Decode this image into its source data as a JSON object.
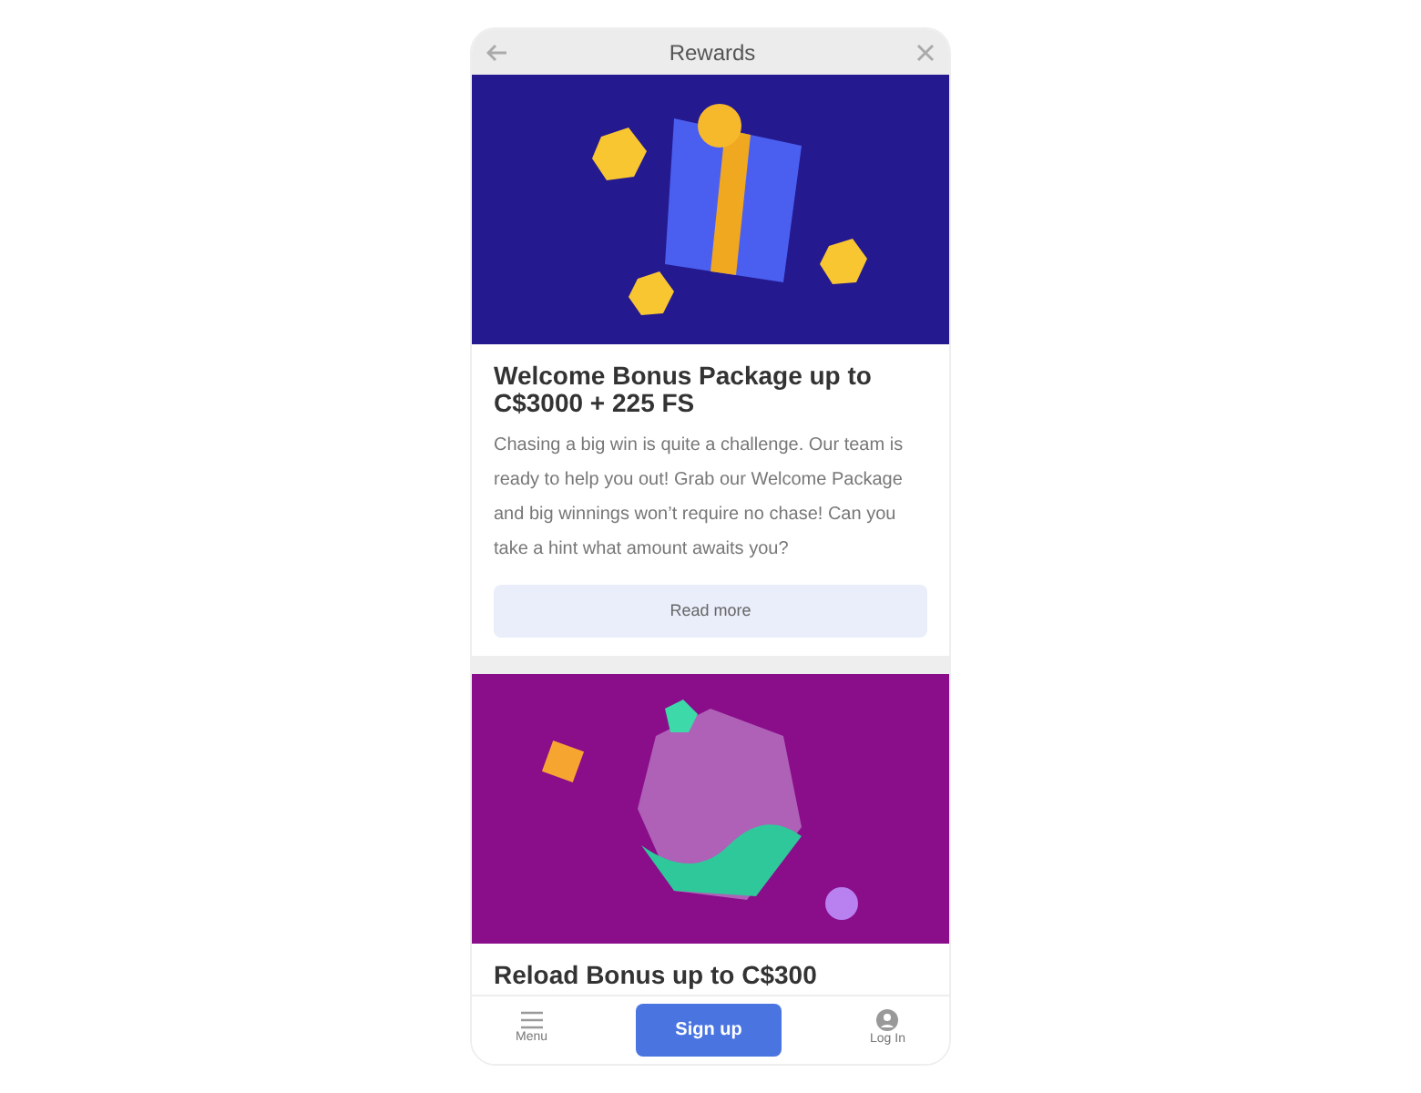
{
  "header": {
    "title": "Rewards"
  },
  "promotions": [
    {
      "kind": "gift",
      "title": "Welcome Bonus Package up to C$3000 + 225 FS",
      "description": "Chasing a big win is quite a challenge. Our team is ready to help you out! Grab our Welcome Package and big winnings won’t require no chase! Can you take a hint what amount awaits you?",
      "button": "Read more"
    },
    {
      "kind": "gem",
      "title": "Reload Bonus up to C$300"
    }
  ],
  "bottom_nav": {
    "menu": "Menu",
    "signup": "Sign up",
    "login": "Log In"
  }
}
